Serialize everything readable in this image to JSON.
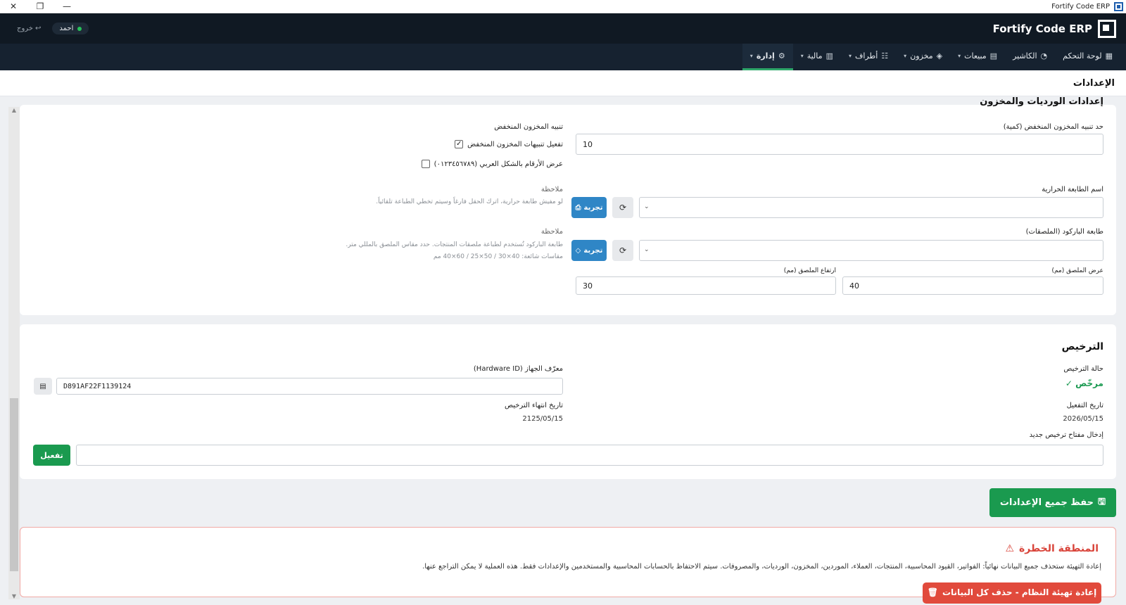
{
  "window": {
    "title": "Fortify Code ERP"
  },
  "header": {
    "brand": "Fortify Code ERP",
    "user_name": "احمد",
    "logout_label": "خروج"
  },
  "nav": {
    "items": [
      {
        "label": "لوحة التحكم",
        "icon": "dashboard-icon",
        "glyph": "▦",
        "has_dropdown": false,
        "active": false
      },
      {
        "label": "الكاشير",
        "icon": "cashier-icon",
        "glyph": "◔",
        "has_dropdown": false,
        "active": false
      },
      {
        "label": "مبيعات",
        "icon": "sales-icon",
        "glyph": "▤",
        "has_dropdown": true,
        "active": false
      },
      {
        "label": "مخزون",
        "icon": "box-icon",
        "glyph": "◈",
        "has_dropdown": true,
        "active": false
      },
      {
        "label": "أطراف",
        "icon": "users-icon",
        "glyph": "☷",
        "has_dropdown": true,
        "active": false
      },
      {
        "label": "مالية",
        "icon": "finance-icon",
        "glyph": "▥",
        "has_dropdown": true,
        "active": false
      },
      {
        "label": "إدارة",
        "icon": "gear-icon",
        "glyph": "⚙",
        "has_dropdown": true,
        "active": true
      }
    ]
  },
  "page": {
    "title": "الإعدادات"
  },
  "inventory": {
    "section_title": "إعدادات الورديات والمخزون",
    "low_stock_threshold_label": "حد تنبيه المخزون المنخفض (كمية)",
    "low_stock_threshold_value": "10",
    "low_stock_alert_heading": "تنبيه المخزون المنخفض",
    "enable_alerts_label": "تفعيل تنبيهات المخزون المنخفض",
    "enable_alerts_checked": true,
    "arabic_numerals_label": "عرض الأرقام بالشكل العربي (٠١٢٣٤٥٦٧٨٩)",
    "arabic_numerals_checked": false,
    "thermal_printer_label": "اسم الطابعة الحرارية",
    "thermal_printer_value": "",
    "note_label": "ملاحظة",
    "thermal_note": "لو مفيش طابعة حرارية، اترك الحقل فارغاً وسيتم تخطي الطباعة تلقائياً.",
    "test_label": "تجربة",
    "barcode_printer_label": "طابعة الباركود (الملصقات)",
    "barcode_printer_value": "",
    "barcode_note_1": "طابعة الباركود تُستخدم لطباعة ملصقات المنتجات. حدد مقاس الملصق بالمللي متر.",
    "barcode_note_2": "مقاسات شائعة: 40×30 / 50×25 / 60×40 مم",
    "label_width_label": "عرض الملصق (مم)",
    "label_width_value": "40",
    "label_height_label": "ارتفاع الملصق (مم)",
    "label_height_value": "30"
  },
  "license": {
    "section_title": "الترخيص",
    "status_label": "حالة الترخيص",
    "status_value": "مرخّص ✓",
    "hardware_id_label": "معرّف الجهاز (Hardware ID)",
    "hardware_id_value": "D891AF22F1139124",
    "activation_date_label": "تاريخ التفعيل",
    "activation_date_value": "2026/05/15",
    "expiry_date_label": "تاريخ انتهاء الترخيص",
    "expiry_date_value": "2125/05/15",
    "new_key_label": "إدخال مفتاح ترخيص جديد",
    "new_key_value": "",
    "activate_label": "تفعيل"
  },
  "actions": {
    "save_all_label": "حفظ جميع الإعدادات"
  },
  "danger": {
    "title": "المنطقة الخطرة",
    "description": "إعادة التهيئة ستحذف جميع البيانات نهائياً: الفواتير، القيود المحاسبية، المنتجات، العملاء، الموردين، المخزون، الورديات، والمصروفات. سيتم الاحتفاظ بالحسابات المحاسبية والمستخدمين والإعدادات فقط. هذه العملية لا يمكن التراجع عنها.",
    "reset_label": "إعادة تهيئة النظام - حذف كل البيانات"
  },
  "colors": {
    "header_bg": "#101923",
    "nav_bg": "#162230",
    "active_underline": "#2ea76a",
    "primary_blue": "#2f86c6",
    "success_green": "#1a9a4f",
    "danger_red": "#e14a3c"
  }
}
